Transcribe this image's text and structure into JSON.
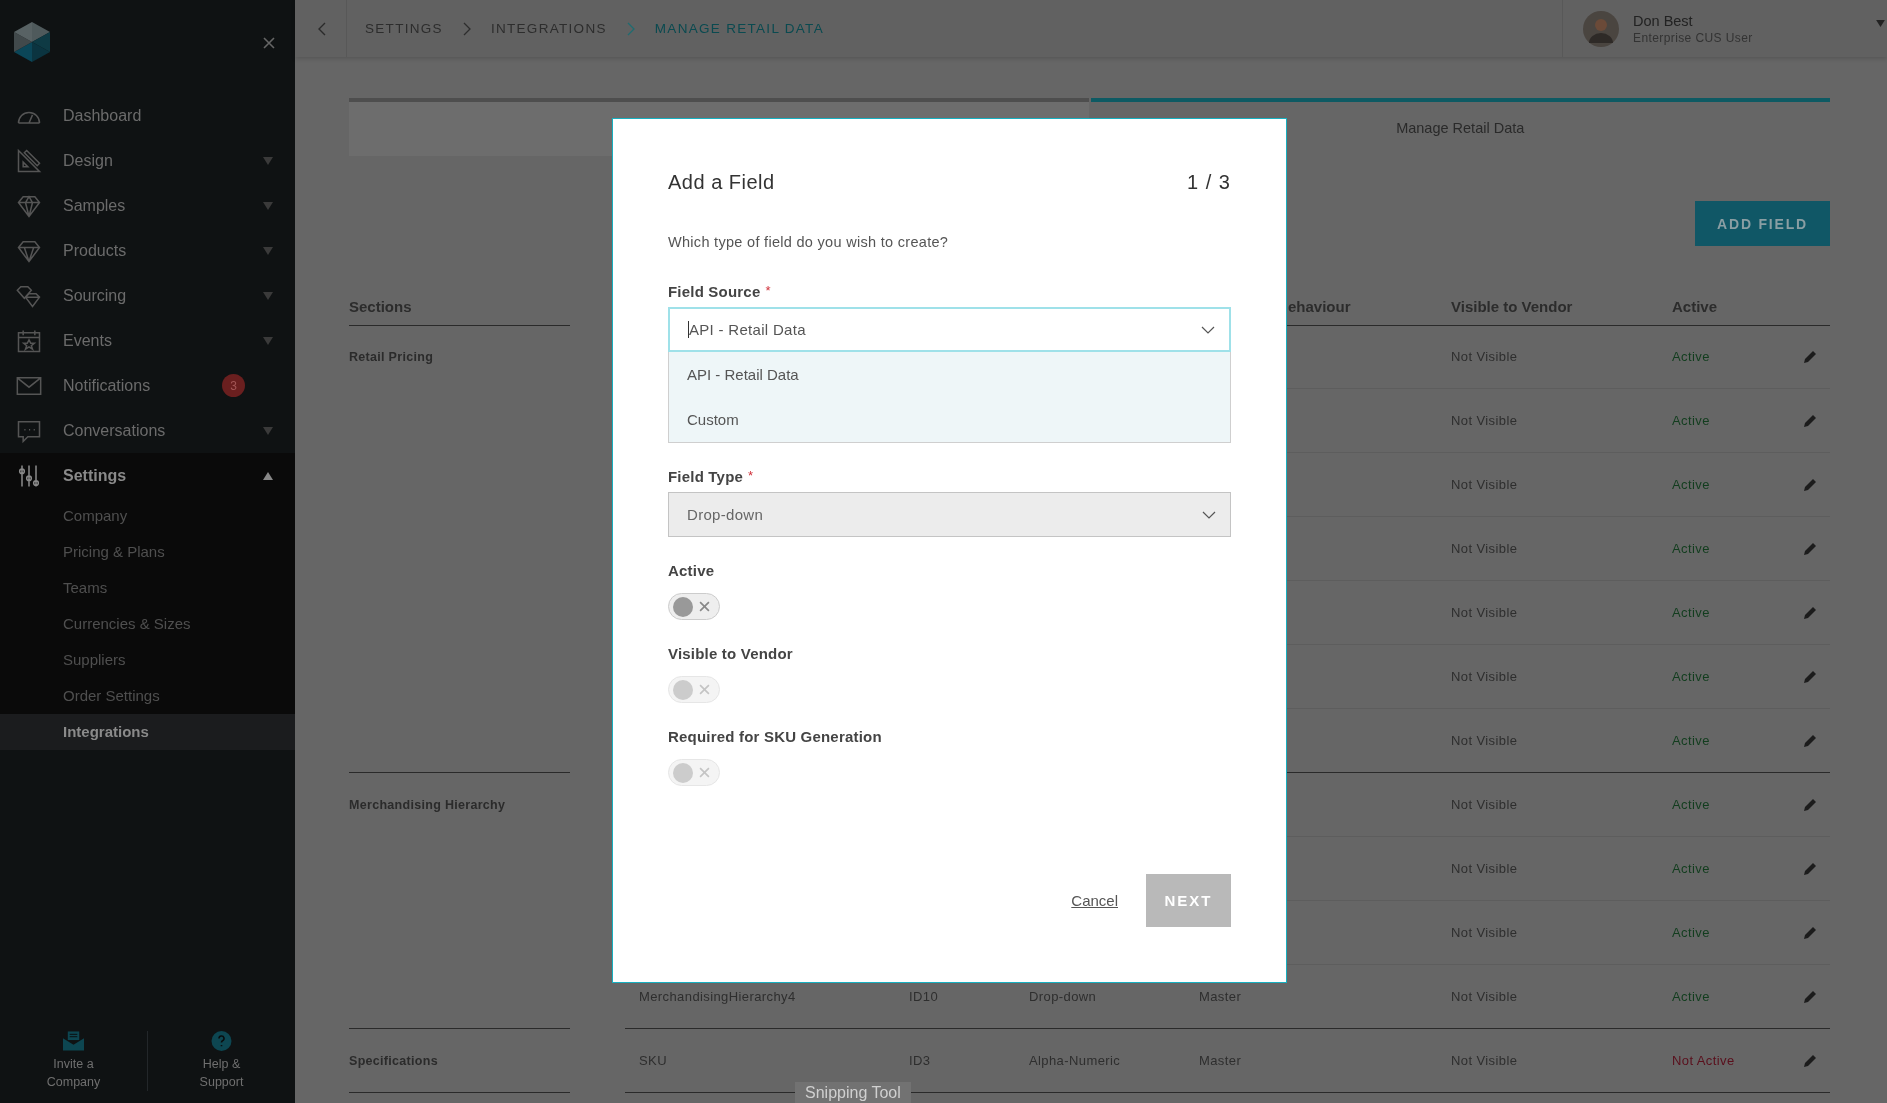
{
  "sidebar": {
    "items": [
      {
        "label": "Dashboard"
      },
      {
        "label": "Design",
        "expanded": false
      },
      {
        "label": "Samples",
        "expanded": false
      },
      {
        "label": "Products",
        "expanded": false
      },
      {
        "label": "Sourcing",
        "expanded": false
      },
      {
        "label": "Events",
        "expanded": false
      },
      {
        "label": "Notifications",
        "badge": "3"
      },
      {
        "label": "Conversations",
        "expanded": false
      },
      {
        "label": "Settings",
        "expanded": true,
        "children": [
          {
            "label": "Company",
            "selected": false
          },
          {
            "label": "Pricing & Plans",
            "selected": false
          },
          {
            "label": "Teams",
            "selected": false
          },
          {
            "label": "Currencies & Sizes",
            "selected": false
          },
          {
            "label": "Suppliers",
            "selected": false
          },
          {
            "label": "Order Settings",
            "selected": false
          },
          {
            "label": "Integrations",
            "selected": true
          }
        ]
      }
    ],
    "footer": [
      {
        "label": "Invite a Company"
      },
      {
        "label": "Help & Support"
      }
    ]
  },
  "topbar": {
    "breadcrumbs": [
      {
        "label": "SETTINGS",
        "selected": false
      },
      {
        "label": "INTEGRATIONS",
        "selected": false
      },
      {
        "label": "MANAGE RETAIL DATA",
        "selected": true
      }
    ],
    "user": {
      "name": "Don Best",
      "role": "Enterprise CUS User"
    }
  },
  "steps": [
    {
      "selected": false
    },
    {
      "label": "Manage Retail Data",
      "selected": true
    }
  ],
  "add_button": "ADD FIELD",
  "table": {
    "section_header": "Sections",
    "columns": [
      "ehaviour",
      "Visible to Vendor",
      "Active"
    ],
    "sections": [
      {
        "name": "Retail Pricing",
        "rows": [
          {
            "visibility": "Not Visible",
            "status": "Active",
            "active": true
          },
          {
            "visibility": "Not Visible",
            "status": "Active",
            "active": true
          },
          {
            "visibility": "Not Visible",
            "status": "Active",
            "active": true
          },
          {
            "visibility": "Not Visible",
            "status": "Active",
            "active": true
          },
          {
            "visibility": "Not Visible",
            "status": "Active",
            "active": true
          },
          {
            "visibility": "Not Visible",
            "status": "Active",
            "active": true
          },
          {
            "visibility": "Not Visible",
            "status": "Active",
            "active": true
          }
        ]
      },
      {
        "name": "Merchandising Hierarchy",
        "rows": [
          {
            "visibility": "Not Visible",
            "status": "Active",
            "active": true
          },
          {
            "visibility": "Not Visible",
            "status": "Active",
            "active": true
          },
          {
            "visibility": "Not Visible",
            "status": "Active",
            "active": true
          },
          {
            "name": "MerchandisingHierarchy4",
            "id": "ID10",
            "type": "Drop-down",
            "behaviour": "Master",
            "visibility": "Not Visible",
            "status": "Active",
            "active": true
          }
        ]
      },
      {
        "name": "Specifications",
        "rows": [
          {
            "name": "SKU",
            "id": "ID3",
            "type": "Alpha-Numeric",
            "behaviour": "Master",
            "visibility": "Not Visible",
            "status": "Not Active",
            "active": false
          }
        ]
      }
    ]
  },
  "modal": {
    "title": "Add a Field",
    "step": "1 / 3",
    "question": "Which type of field do you wish to create?",
    "field_source": {
      "label": "Field Source",
      "required_mark": "*",
      "value": "API - Retail Data",
      "focused": true,
      "expanded": true,
      "options": [
        "API - Retail Data",
        "Custom"
      ]
    },
    "field_type": {
      "label": "Field Type",
      "required_mark": "*",
      "value": "Drop-down",
      "disabled": true
    },
    "toggles": [
      {
        "label": "Active",
        "on": false,
        "disabled": false
      },
      {
        "label": "Visible to Vendor",
        "on": false,
        "disabled": true
      },
      {
        "label": "Required for SKU Generation",
        "on": false,
        "disabled": true
      }
    ],
    "cancel": "Cancel",
    "next": {
      "label": "NEXT",
      "disabled": true
    }
  },
  "os_tooltip": "Snipping Tool"
}
